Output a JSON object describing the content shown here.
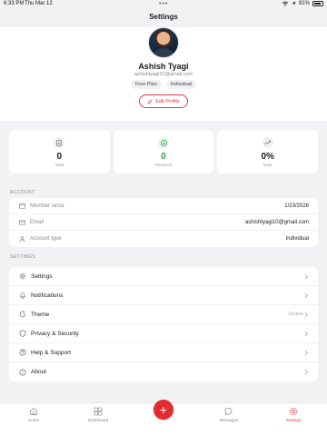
{
  "status_bar": {
    "time": "6:33 PM",
    "date": "Thu Mar 12",
    "battery": "81%"
  },
  "header": {
    "title": "Settings"
  },
  "profile": {
    "name": "Ashish Tyagi",
    "email": "ashishtyagi10@gmail.com",
    "chips": [
      "Free Plan",
      "Individual"
    ],
    "edit_label": "Edit Profile"
  },
  "stats": [
    {
      "value": "0",
      "label": "Total",
      "icon": "document-icon"
    },
    {
      "value": "0",
      "label": "Resolved",
      "icon": "check-circle-icon",
      "color": "#2f9a4b"
    },
    {
      "value": "0%",
      "label": "Rate",
      "icon": "trend-up-icon"
    }
  ],
  "account": {
    "section_label": "ACCOUNT",
    "rows": [
      {
        "label": "Member since",
        "value": "1/23/2026",
        "icon": "calendar-icon"
      },
      {
        "label": "Email",
        "value": "ashishtyagi10@gmail.com",
        "icon": "mail-icon"
      },
      {
        "label": "Account type",
        "value": "Individual",
        "icon": "user-icon"
      }
    ]
  },
  "settings": {
    "section_label": "SETTINGS",
    "rows": [
      {
        "label": "Settings",
        "value": "",
        "icon": "gear-icon"
      },
      {
        "label": "Notifications",
        "value": "",
        "icon": "bell-icon"
      },
      {
        "label": "Theme",
        "value": "System",
        "icon": "moon-icon"
      },
      {
        "label": "Privacy & Security",
        "value": "",
        "icon": "shield-icon"
      },
      {
        "label": "Help & Support",
        "value": "",
        "icon": "help-icon"
      },
      {
        "label": "About",
        "value": "",
        "icon": "info-icon"
      }
    ]
  },
  "tabs": [
    {
      "label": "Home",
      "icon": "home-icon"
    },
    {
      "label": "Dashboard",
      "icon": "grid-icon"
    },
    {
      "label": "Messages",
      "icon": "chat-icon"
    },
    {
      "label": "Settings",
      "icon": "gear-icon",
      "active": true
    }
  ],
  "fab": {
    "label": "+"
  },
  "colors": {
    "accent": "#e03a45",
    "success": "#2f9a4b",
    "background": "#f2f2f4"
  }
}
